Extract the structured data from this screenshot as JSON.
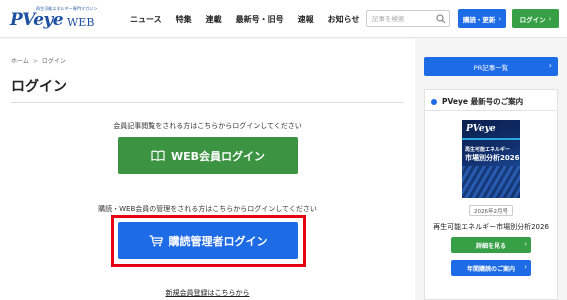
{
  "header": {
    "logo_tagline": "再生可能エネルギー専門マガジン",
    "logo_main": "PVeye",
    "logo_web": "WEB",
    "nav": [
      "ニュース",
      "特集",
      "連載",
      "最新号・旧号",
      "速報",
      "お知らせ"
    ],
    "search_placeholder": "記事を検索",
    "subscribe_label": "購読・更新",
    "login_label": "ログイン"
  },
  "main": {
    "breadcrumb": {
      "home": "ホーム",
      "current": "ログイン",
      "separator": ">"
    },
    "title": "ログイン",
    "member_info": "会員記事閲覧をされる方はこちらからログインしてください",
    "web_login_label": "WEB会員ログイン",
    "manager_info": "購読・WEB会員の管理をされる方はこちらからログインしてください",
    "manager_login_label": "購読管理者ログイン",
    "register_link": "新規会員登録はこちらから"
  },
  "sidebar": {
    "pr_label": "PR記事一覧",
    "latest_heading": "PVeye 最新号のご案内",
    "magazine_logo": "PVeye",
    "magazine_cover_title": "再生可能エネルギー",
    "magazine_cover_title2": "市場別分析2026",
    "issue_date": "2026年2月号",
    "issue_title": "再生可能エネルギー市場別分析2026",
    "detail_label": "詳細を見る",
    "annual_label": "年間購読のご案内"
  },
  "colors": {
    "brand_blue": "#1e50a2",
    "button_blue": "#1e6be6",
    "button_green": "#37a047",
    "highlight_red": "#e60012"
  }
}
